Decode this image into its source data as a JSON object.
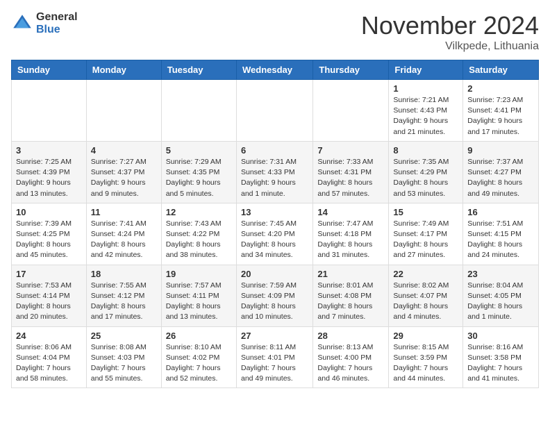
{
  "logo": {
    "general": "General",
    "blue": "Blue"
  },
  "title": "November 2024",
  "location": "Vilkpede, Lithuania",
  "days_of_week": [
    "Sunday",
    "Monday",
    "Tuesday",
    "Wednesday",
    "Thursday",
    "Friday",
    "Saturday"
  ],
  "weeks": [
    [
      {
        "day": "",
        "info": ""
      },
      {
        "day": "",
        "info": ""
      },
      {
        "day": "",
        "info": ""
      },
      {
        "day": "",
        "info": ""
      },
      {
        "day": "",
        "info": ""
      },
      {
        "day": "1",
        "info": "Sunrise: 7:21 AM\nSunset: 4:43 PM\nDaylight: 9 hours and 21 minutes."
      },
      {
        "day": "2",
        "info": "Sunrise: 7:23 AM\nSunset: 4:41 PM\nDaylight: 9 hours and 17 minutes."
      }
    ],
    [
      {
        "day": "3",
        "info": "Sunrise: 7:25 AM\nSunset: 4:39 PM\nDaylight: 9 hours and 13 minutes."
      },
      {
        "day": "4",
        "info": "Sunrise: 7:27 AM\nSunset: 4:37 PM\nDaylight: 9 hours and 9 minutes."
      },
      {
        "day": "5",
        "info": "Sunrise: 7:29 AM\nSunset: 4:35 PM\nDaylight: 9 hours and 5 minutes."
      },
      {
        "day": "6",
        "info": "Sunrise: 7:31 AM\nSunset: 4:33 PM\nDaylight: 9 hours and 1 minute."
      },
      {
        "day": "7",
        "info": "Sunrise: 7:33 AM\nSunset: 4:31 PM\nDaylight: 8 hours and 57 minutes."
      },
      {
        "day": "8",
        "info": "Sunrise: 7:35 AM\nSunset: 4:29 PM\nDaylight: 8 hours and 53 minutes."
      },
      {
        "day": "9",
        "info": "Sunrise: 7:37 AM\nSunset: 4:27 PM\nDaylight: 8 hours and 49 minutes."
      }
    ],
    [
      {
        "day": "10",
        "info": "Sunrise: 7:39 AM\nSunset: 4:25 PM\nDaylight: 8 hours and 45 minutes."
      },
      {
        "day": "11",
        "info": "Sunrise: 7:41 AM\nSunset: 4:24 PM\nDaylight: 8 hours and 42 minutes."
      },
      {
        "day": "12",
        "info": "Sunrise: 7:43 AM\nSunset: 4:22 PM\nDaylight: 8 hours and 38 minutes."
      },
      {
        "day": "13",
        "info": "Sunrise: 7:45 AM\nSunset: 4:20 PM\nDaylight: 8 hours and 34 minutes."
      },
      {
        "day": "14",
        "info": "Sunrise: 7:47 AM\nSunset: 4:18 PM\nDaylight: 8 hours and 31 minutes."
      },
      {
        "day": "15",
        "info": "Sunrise: 7:49 AM\nSunset: 4:17 PM\nDaylight: 8 hours and 27 minutes."
      },
      {
        "day": "16",
        "info": "Sunrise: 7:51 AM\nSunset: 4:15 PM\nDaylight: 8 hours and 24 minutes."
      }
    ],
    [
      {
        "day": "17",
        "info": "Sunrise: 7:53 AM\nSunset: 4:14 PM\nDaylight: 8 hours and 20 minutes."
      },
      {
        "day": "18",
        "info": "Sunrise: 7:55 AM\nSunset: 4:12 PM\nDaylight: 8 hours and 17 minutes."
      },
      {
        "day": "19",
        "info": "Sunrise: 7:57 AM\nSunset: 4:11 PM\nDaylight: 8 hours and 13 minutes."
      },
      {
        "day": "20",
        "info": "Sunrise: 7:59 AM\nSunset: 4:09 PM\nDaylight: 8 hours and 10 minutes."
      },
      {
        "day": "21",
        "info": "Sunrise: 8:01 AM\nSunset: 4:08 PM\nDaylight: 8 hours and 7 minutes."
      },
      {
        "day": "22",
        "info": "Sunrise: 8:02 AM\nSunset: 4:07 PM\nDaylight: 8 hours and 4 minutes."
      },
      {
        "day": "23",
        "info": "Sunrise: 8:04 AM\nSunset: 4:05 PM\nDaylight: 8 hours and 1 minute."
      }
    ],
    [
      {
        "day": "24",
        "info": "Sunrise: 8:06 AM\nSunset: 4:04 PM\nDaylight: 7 hours and 58 minutes."
      },
      {
        "day": "25",
        "info": "Sunrise: 8:08 AM\nSunset: 4:03 PM\nDaylight: 7 hours and 55 minutes."
      },
      {
        "day": "26",
        "info": "Sunrise: 8:10 AM\nSunset: 4:02 PM\nDaylight: 7 hours and 52 minutes."
      },
      {
        "day": "27",
        "info": "Sunrise: 8:11 AM\nSunset: 4:01 PM\nDaylight: 7 hours and 49 minutes."
      },
      {
        "day": "28",
        "info": "Sunrise: 8:13 AM\nSunset: 4:00 PM\nDaylight: 7 hours and 46 minutes."
      },
      {
        "day": "29",
        "info": "Sunrise: 8:15 AM\nSunset: 3:59 PM\nDaylight: 7 hours and 44 minutes."
      },
      {
        "day": "30",
        "info": "Sunrise: 8:16 AM\nSunset: 3:58 PM\nDaylight: 7 hours and 41 minutes."
      }
    ]
  ]
}
